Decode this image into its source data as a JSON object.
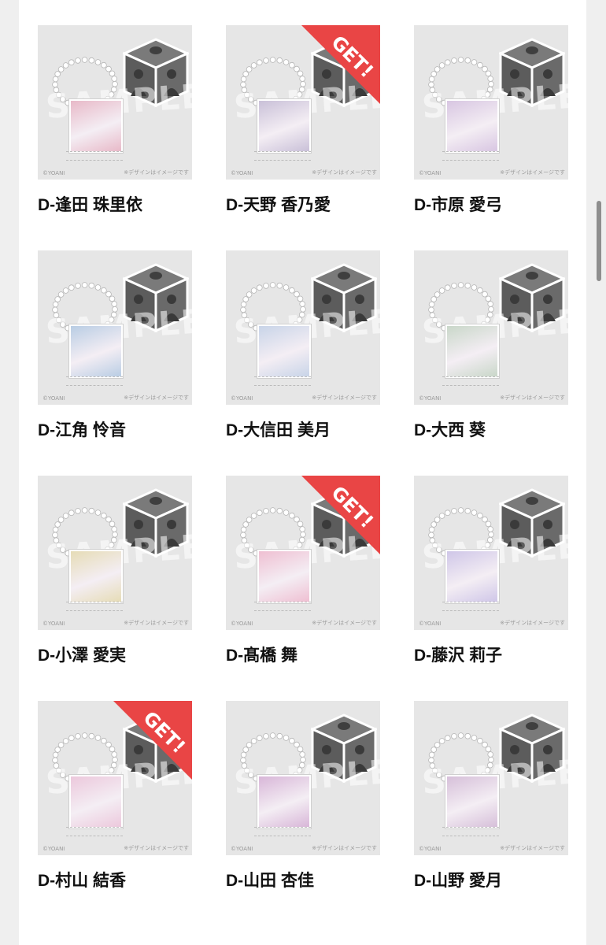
{
  "watermark_text": "SAMPLE",
  "copyright_text": "©YOANI",
  "design_note": "※デザインはイメージです",
  "get_label": "GET!",
  "colors": {
    "ribbon": "#e94545",
    "thumb_bg": "#e6e6e6",
    "name_text": "#111111"
  },
  "items": [
    {
      "name": "D-逢田 珠里依",
      "got": false,
      "tint": "#e8b9c8"
    },
    {
      "name": "D-天野 香乃愛",
      "got": true,
      "tint": "#c9c0d8"
    },
    {
      "name": "D-市原 愛弓",
      "got": false,
      "tint": "#d8c6e2"
    },
    {
      "name": "D-江角 怜音",
      "got": false,
      "tint": "#b9cde4"
    },
    {
      "name": "D-大信田 美月",
      "got": false,
      "tint": "#c8d4e8"
    },
    {
      "name": "D-大西 葵",
      "got": false,
      "tint": "#c9d7c9"
    },
    {
      "name": "D-小澤 愛実",
      "got": false,
      "tint": "#e6dcb6"
    },
    {
      "name": "D-髙橋 舞",
      "got": true,
      "tint": "#efbfd2"
    },
    {
      "name": "D-藤沢 莉子",
      "got": false,
      "tint": "#cfc6e8"
    },
    {
      "name": "D-村山 結香",
      "got": true,
      "tint": "#ecc8dc"
    },
    {
      "name": "D-山田 杏佳",
      "got": false,
      "tint": "#d8b6d8"
    },
    {
      "name": "D-山野 愛月",
      "got": false,
      "tint": "#d6bfd9"
    }
  ]
}
